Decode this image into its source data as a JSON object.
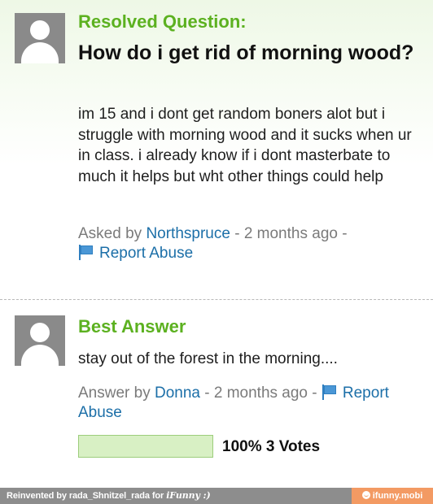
{
  "question": {
    "status": "Resolved Question:",
    "title": "How do i get rid of morning wood?",
    "body": "im 15 and i dont get random boners alot but i struggle with morning wood and it sucks when ur in class. i already know if i dont masterbate to much it helps but wht other things could help",
    "asked_prefix": "Asked by",
    "asker": "Northspruce",
    "time_text": " - 2 months ago -",
    "report_label": "Report Abuse",
    "avatar_icon": "user-silhouette-icon"
  },
  "best_answer": {
    "heading": "Best Answer",
    "text": "stay out of the forest in the morning....",
    "answer_prefix": "Answer by",
    "answerer": "Donna",
    "time_text": " - 2 months ago -",
    "report_label": "Report Abuse",
    "vote_fraction": 1.0,
    "vote_label": "100% 3 Votes",
    "avatar_icon": "user-silhouette-icon"
  },
  "footer": {
    "credit_prefix": "Reinvented by rada_Shnitzel_rada for",
    "credit_brand": "iFunny :)",
    "badge": "ifunny.mobi"
  },
  "colors": {
    "accent_green": "#5cb120",
    "link_blue": "#1c6fa8",
    "footer_gray": "#8d8d8d",
    "badge_orange": "#f39a63"
  }
}
